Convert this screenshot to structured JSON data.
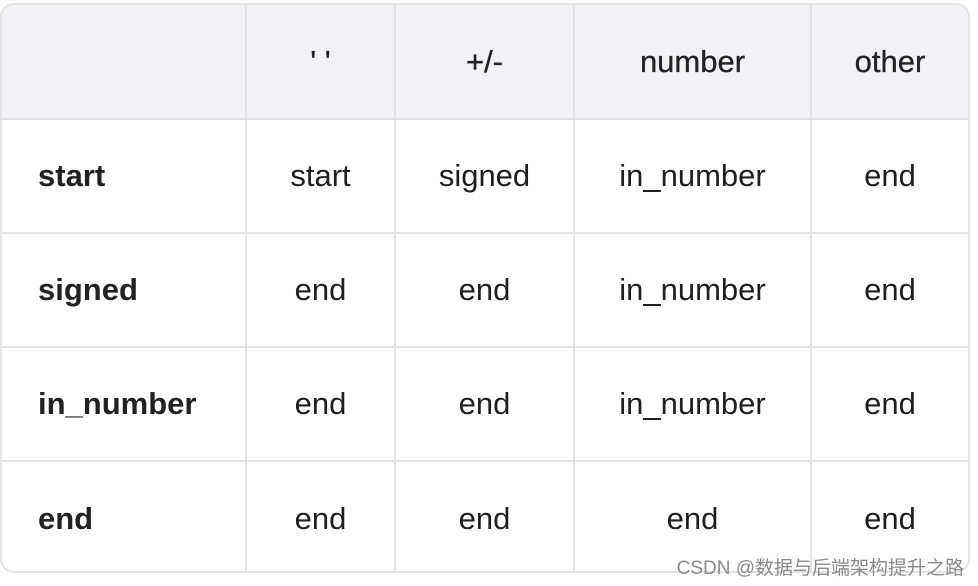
{
  "table": {
    "columns": [
      "",
      "' '",
      "+/-",
      "number",
      "other"
    ],
    "rows": [
      {
        "state": "start",
        "cells": [
          "start",
          "signed",
          "in_number",
          "end"
        ]
      },
      {
        "state": "signed",
        "cells": [
          "end",
          "end",
          "in_number",
          "end"
        ]
      },
      {
        "state": "in_number",
        "cells": [
          "end",
          "end",
          "in_number",
          "end"
        ]
      },
      {
        "state": "end",
        "cells": [
          "end",
          "end",
          "end",
          "end"
        ]
      }
    ]
  },
  "watermark": "CSDN @数据与后端架构提升之路"
}
